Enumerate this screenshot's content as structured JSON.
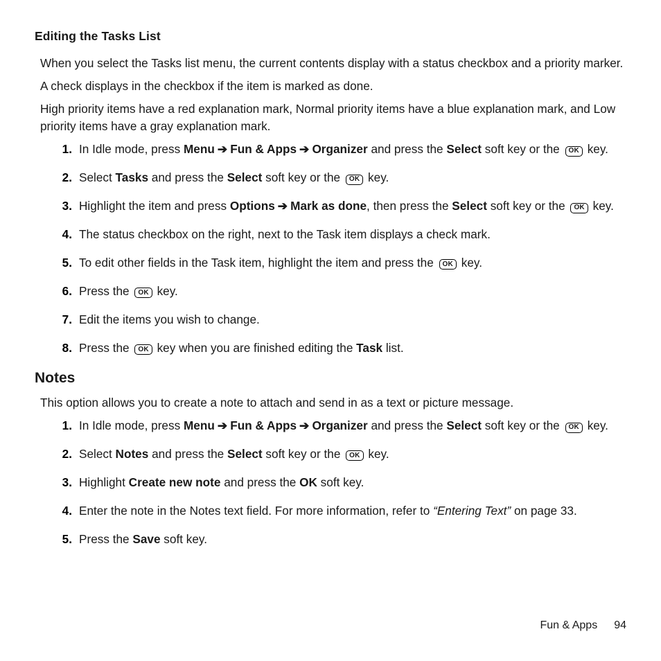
{
  "section1": {
    "heading": "Editing the Tasks List",
    "p1": "When you select the Tasks list menu, the current contents display with a status checkbox and a priority marker.",
    "p2": "A check displays in the checkbox if the item is marked as done.",
    "p3": "High priority items have a red explanation mark, Normal priority items have a blue explanation mark, and Low priority items have a gray explanation mark.",
    "steps": {
      "s1a": "In Idle mode, press ",
      "s1_menu": "Menu",
      "s1_fa": "Fun & Apps",
      "s1_org": "Organizer",
      "s1b": " and press the ",
      "s1_select": "Select",
      "s1c": " soft key or the ",
      "s1d": " key.",
      "s2a": "Select ",
      "s2_tasks": "Tasks",
      "s2b": " and press the ",
      "s2_select": "Select",
      "s2c": " soft key or the ",
      "s2d": " key.",
      "s3a": "Highlight the item and press ",
      "s3_options": "Options",
      "s3_mark": "Mark as done",
      "s3b": ", then press the ",
      "s3_select": "Select",
      "s3c": " soft key or the ",
      "s3d": " key.",
      "s4": "The status checkbox on the right, next to the Task item displays a check mark.",
      "s5a": "To edit other fields in the Task item, highlight the item and press the ",
      "s5b": " key.",
      "s6a": "Press the ",
      "s6b": " key.",
      "s7": "Edit the items you wish to change.",
      "s8a": "Press the ",
      "s8b": " key when you are finished editing the ",
      "s8_task": "Task",
      "s8c": " list."
    }
  },
  "section2": {
    "heading": "Notes",
    "p1": "This option allows you to create a note to attach and send in as a text or picture message.",
    "steps": {
      "s1a": "In Idle mode, press ",
      "s1_menu": "Menu",
      "s1_fa": "Fun & Apps",
      "s1_org": "Organizer",
      "s1b": " and press the ",
      "s1_select": "Select",
      "s1c": " soft key or the ",
      "s1d": " key.",
      "s2a": "Select ",
      "s2_notes": "Notes",
      "s2b": " and press the ",
      "s2_select": "Select",
      "s2c": " soft key or the ",
      "s2d": " key.",
      "s3a": "Highlight ",
      "s3_create": "Create new note",
      "s3b": " and press the ",
      "s3_ok": "OK",
      "s3c": " soft key.",
      "s4a": "Enter the note in the Notes text field. For more information, refer to ",
      "s4_quote": "“Entering Text”",
      "s4b": "  on page 33.",
      "s5a": "Press the ",
      "s5_save": "Save",
      "s5b": " soft key."
    }
  },
  "num": {
    "n1": "1.",
    "n2": "2.",
    "n3": "3.",
    "n4": "4.",
    "n5": "5.",
    "n6": "6.",
    "n7": "7.",
    "n8": "8."
  },
  "arrow": "➔",
  "ok": "OK",
  "footer": {
    "section": "Fun & Apps",
    "page": "94"
  }
}
